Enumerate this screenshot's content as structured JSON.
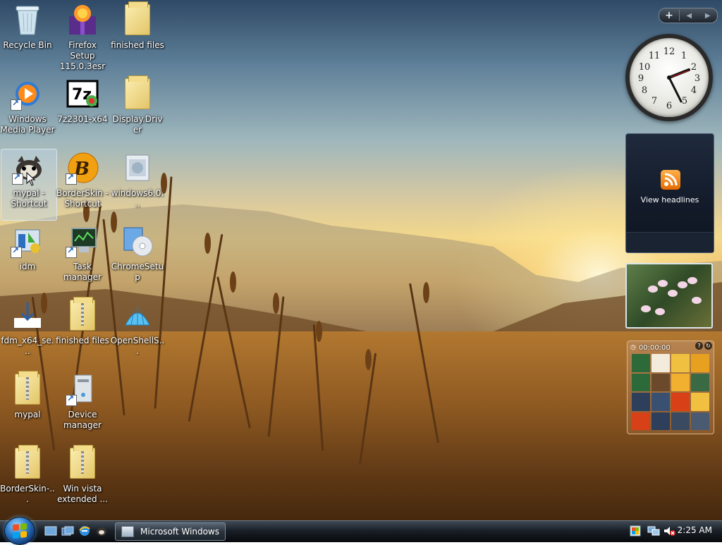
{
  "desktop": {
    "icons": [
      {
        "id": "recycle-bin",
        "label": "Recycle Bin"
      },
      {
        "id": "firefox-setup",
        "label": "Firefox Setup 115.0.3esr"
      },
      {
        "id": "finished-files-1",
        "label": "finished files"
      },
      {
        "id": "windows-media-player",
        "label": "Windows Media Player"
      },
      {
        "id": "7z2301-x64",
        "label": "7z2301-x64"
      },
      {
        "id": "display-driver",
        "label": "Display.Driver"
      },
      {
        "id": "mypal-shortcut",
        "label": "mypal - Shortcut"
      },
      {
        "id": "borderskin-shortcut",
        "label": "BorderSkin - Shortcut"
      },
      {
        "id": "windows6",
        "label": "windows6.0..."
      },
      {
        "id": "idm",
        "label": "idm"
      },
      {
        "id": "task-manager",
        "label": "Task manager"
      },
      {
        "id": "chromesetup",
        "label": "ChromeSetup"
      },
      {
        "id": "fdm-x64",
        "label": "fdm_x64_se..."
      },
      {
        "id": "finished-files-2",
        "label": "finished files"
      },
      {
        "id": "openshell",
        "label": "OpenShellS..."
      },
      {
        "id": "mypal",
        "label": "mypal"
      },
      {
        "id": "device-manager",
        "label": "Device manager"
      },
      {
        "id": "borderskin-zip",
        "label": "BorderSkin-..."
      },
      {
        "id": "win-vista-extended",
        "label": "Win vista extended ..."
      }
    ]
  },
  "sidebar": {
    "clock": {
      "time": "2:25"
    },
    "feed": {
      "label": "View headlines"
    },
    "puzzle": {
      "timer": "00:00:00"
    }
  },
  "taskbar": {
    "window_button": {
      "label": "Microsoft Windows"
    },
    "clock": "2:25 AM"
  },
  "colors": {
    "taskbar": "#1a2028",
    "accent": "#2f7fd0",
    "rss": "#f08a1c"
  }
}
